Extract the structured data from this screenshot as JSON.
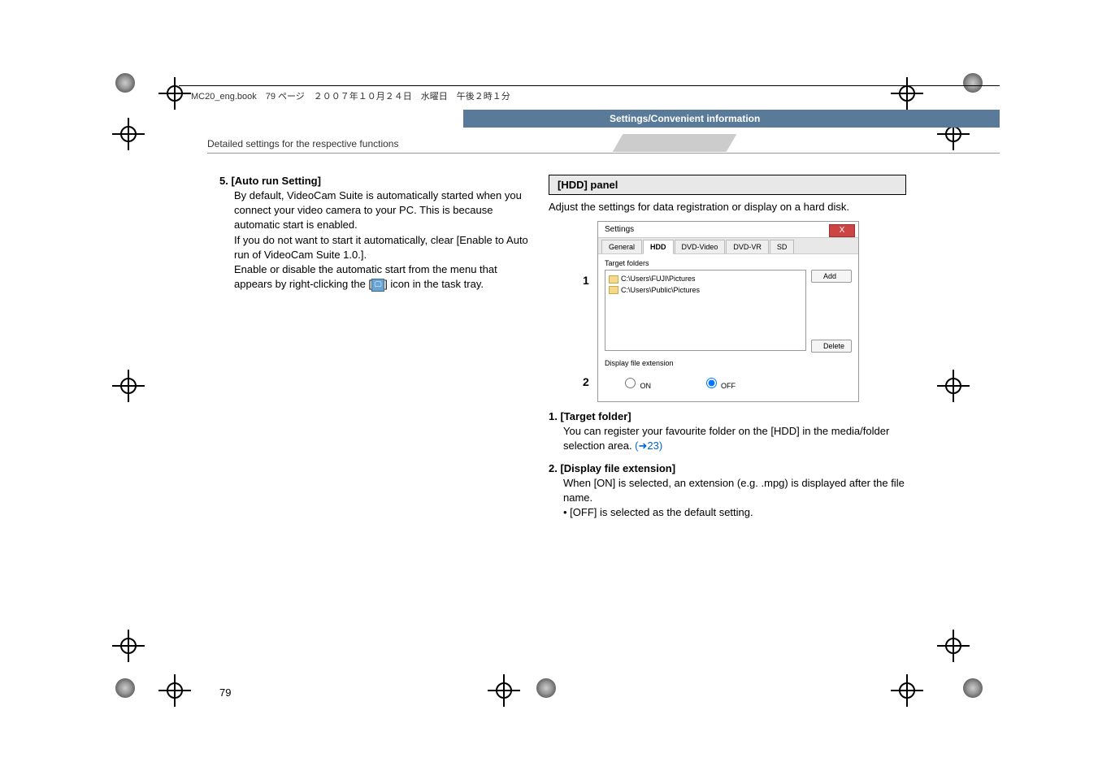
{
  "header": {
    "file_info": "MC20_eng.book　79 ページ　２００７年１０月２４日　水曜日　午後２時１分",
    "section_title": "Settings/Convenient information",
    "subheader": "Detailed settings for the respective functions"
  },
  "left": {
    "item5_title": "5. [Auto run Setting]",
    "item5_p1": "By default, VideoCam Suite is automatically started when you connect your video camera to your PC. This is because automatic start is enabled.",
    "item5_p2": "If you do not want to start it automatically, clear [Enable to Auto run of VideoCam Suite 1.0.].",
    "item5_p3a": "Enable or disable the automatic start from the menu that appears by right-clicking the [",
    "item5_p3b": "] icon in the task tray."
  },
  "right": {
    "panel_title": "[HDD] panel",
    "panel_desc": "Adjust the settings for data registration or display on a hard disk.",
    "screenshot": {
      "window_title": "Settings",
      "close": "X",
      "tabs": [
        "General",
        "HDD",
        "DVD-Video",
        "DVD-VR",
        "SD"
      ],
      "active_tab_index": 1,
      "target_folders_label": "Target folders",
      "folders": [
        "C:\\Users\\FUJI\\Pictures",
        "C:\\Users\\Public\\Pictures"
      ],
      "add_btn": "Add",
      "delete_btn": "Delete",
      "display_ext_label": "Display file extension",
      "on_label": "ON",
      "off_label": "OFF"
    },
    "callout1": "1",
    "callout2": "2",
    "item1_title": "1. [Target folder]",
    "item1_body_a": "You can register your favourite folder on the [HDD] in the media/folder selection area. ",
    "item1_link": "(➜23)",
    "item2_title": "2. [Display file extension]",
    "item2_body_a": "When [ON] is selected, an extension (e.g. .mpg) is displayed after the file name.",
    "item2_body_b": "• [OFF] is selected as the default setting."
  },
  "page_number": "79"
}
